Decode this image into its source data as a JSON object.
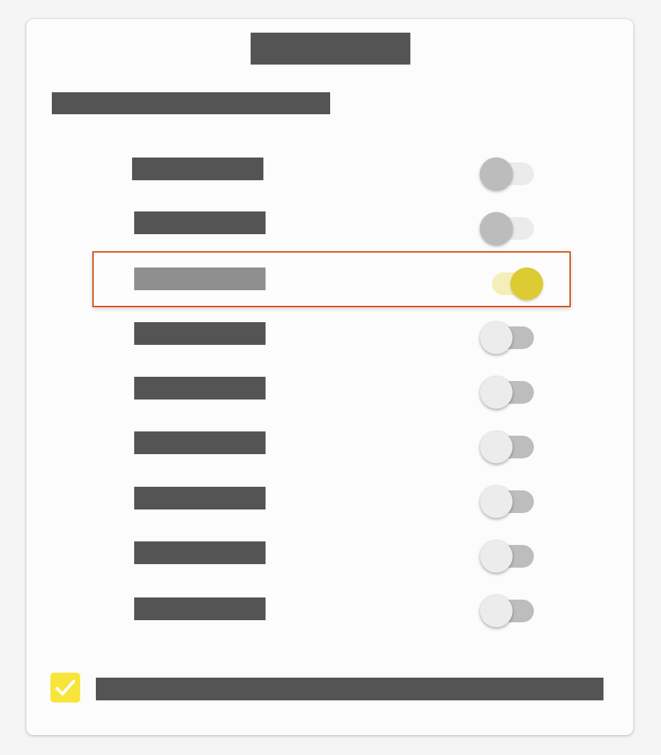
{
  "dialog": {
    "title": "",
    "subtitle": "",
    "colors": {
      "redaction": "#545454",
      "selected_redaction": "#8f8f8f",
      "accent": "#dccb32",
      "highlight_border": "#d2541c",
      "checkbox": "#f7e53b"
    },
    "rows": [
      {
        "label": "",
        "toggle": "off"
      },
      {
        "label": "",
        "toggle": "off"
      },
      {
        "label": "",
        "toggle": "on",
        "highlighted": true
      },
      {
        "label": "",
        "toggle": "off"
      },
      {
        "label": "",
        "toggle": "off"
      },
      {
        "label": "",
        "toggle": "off"
      },
      {
        "label": "",
        "toggle": "off"
      },
      {
        "label": "",
        "toggle": "off"
      },
      {
        "label": "",
        "toggle": "off"
      }
    ],
    "footer": {
      "checkbox_checked": true,
      "checkbox_icon": "check-icon",
      "label": ""
    }
  }
}
